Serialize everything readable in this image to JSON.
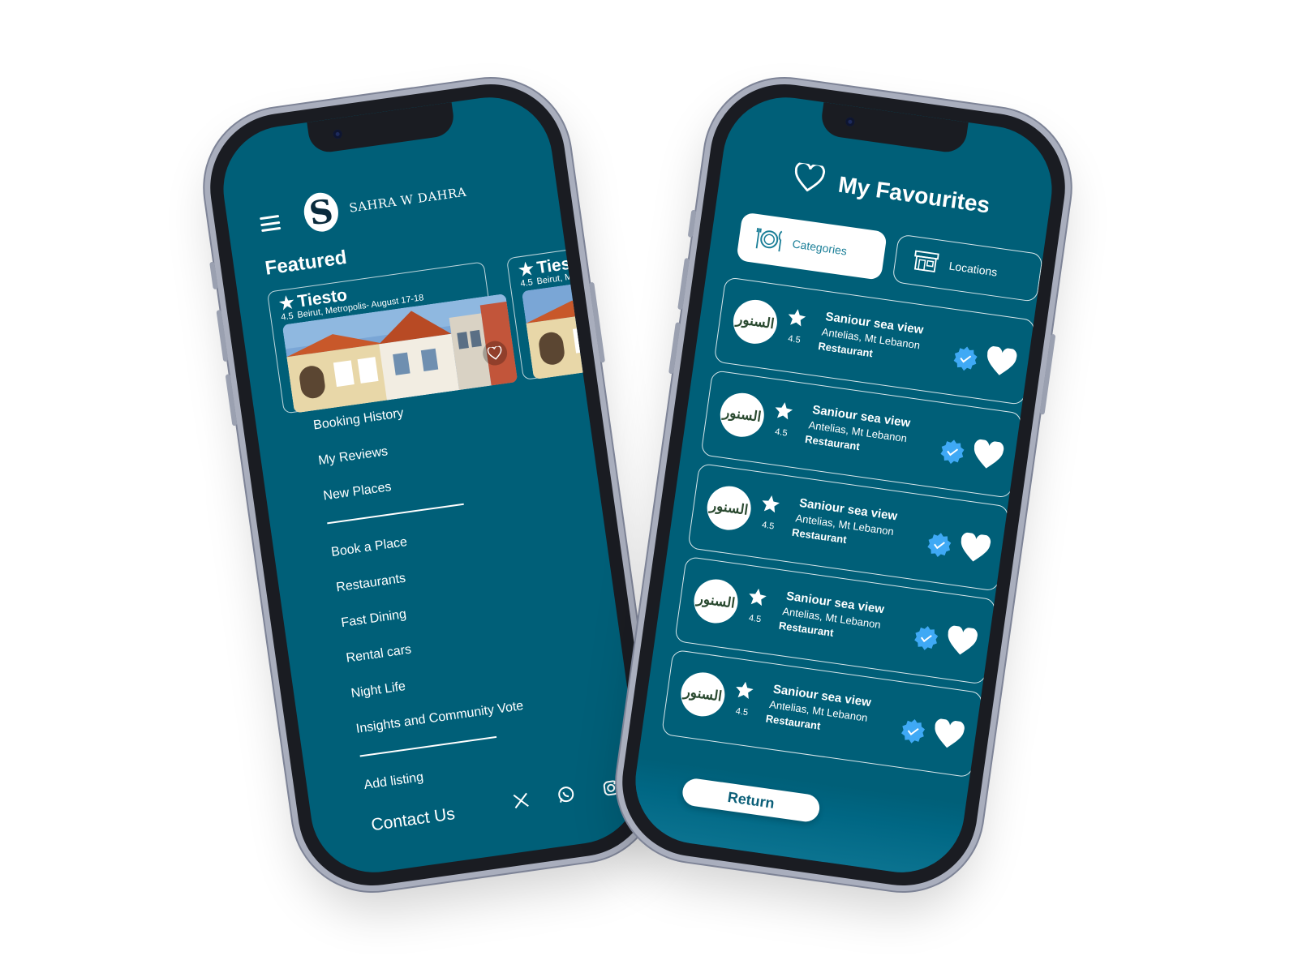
{
  "colors": {
    "primary": "#005f78",
    "card_border": "#ffffff",
    "badge": "#3fa9f5",
    "text": "#ffffff"
  },
  "left_screen": {
    "brand": {
      "mark": "S",
      "name": "SAHRA W DAHRA"
    },
    "featured_title": "Featured",
    "featured": [
      {
        "name": "Tiesto",
        "rating": "4.5",
        "subtitle": "Beirut, Metropolis- August 17-18"
      },
      {
        "name": "Tiesto",
        "rating": "4.5",
        "subtitle": "Beirut, Metro"
      }
    ],
    "menu_group1": [
      "Booking History",
      "My Reviews",
      "New Places"
    ],
    "menu_group2": [
      "Book a Place",
      "Restaurants",
      "Fast Dining",
      "Rental cars",
      "Night Life",
      "Insights and Community Vote"
    ],
    "menu_group3": [
      "Add listing"
    ],
    "contact_label": "Contact Us",
    "socials": [
      "x-icon",
      "whatsapp-icon",
      "instagram-icon",
      "facebook-icon"
    ]
  },
  "right_screen": {
    "title": "My Favourites",
    "tabs": [
      {
        "label": "Categories",
        "icon": "plate-cutlery-icon",
        "active": true
      },
      {
        "label": "Locations",
        "icon": "storefront-icon",
        "active": false
      }
    ],
    "favourites": [
      {
        "name": "Saniour sea view",
        "location": "Antelias, Mt Lebanon",
        "type": "Restaurant",
        "rating": "4.5",
        "logo": "السنور"
      },
      {
        "name": "Saniour sea view",
        "location": "Antelias, Mt Lebanon",
        "type": "Restaurant",
        "rating": "4.5",
        "logo": "السنور"
      },
      {
        "name": "Saniour sea view",
        "location": "Antelias, Mt Lebanon",
        "type": "Restaurant",
        "rating": "4.5",
        "logo": "السنور"
      },
      {
        "name": "Saniour sea view",
        "location": "Antelias, Mt Lebanon",
        "type": "Restaurant",
        "rating": "4.5",
        "logo": "السنور"
      },
      {
        "name": "Saniour sea view",
        "location": "Antelias, Mt Lebanon",
        "type": "Restaurant",
        "rating": "4.5",
        "logo": "السنور"
      }
    ],
    "return_label": "Return"
  }
}
